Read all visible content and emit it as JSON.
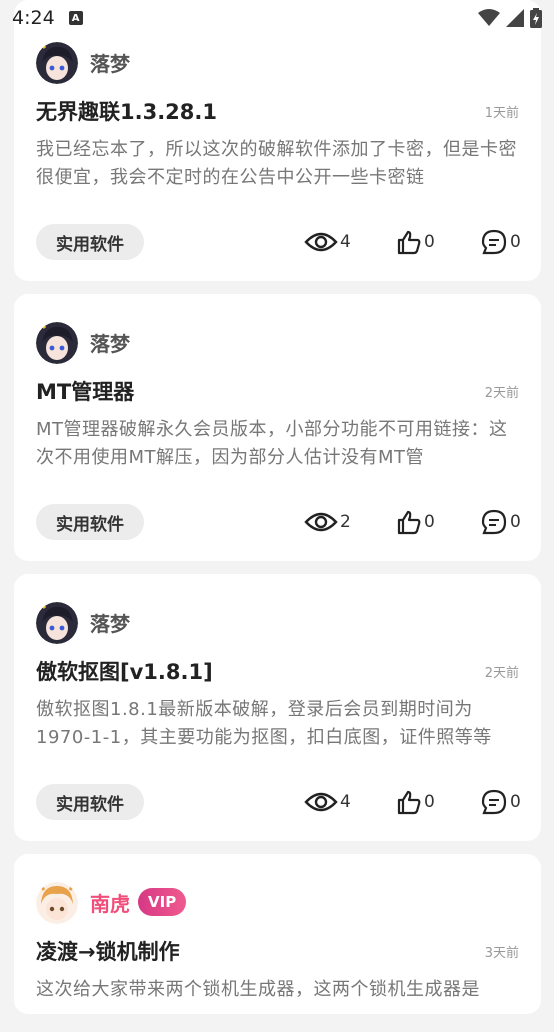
{
  "status_bar": {
    "time": "4:24"
  },
  "posts": [
    {
      "author": "落梦",
      "vip": false,
      "title": "无界趣联1.3.28.1",
      "time": "1天前",
      "summary": "我已经忘本了，所以这次的破解软件添加了卡密，但是卡密很便宜，我会不定时的在公告中公开一些卡密链",
      "tag": "实用软件",
      "views": "4",
      "likes": "0",
      "comments": "0"
    },
    {
      "author": "落梦",
      "vip": false,
      "title": "MT管理器",
      "time": "2天前",
      "summary": "MT管理器破解永久会员版本，小部分功能不可用链接：这次不用使用MT解压，因为部分人估计没有MT管",
      "tag": "实用软件",
      "views": "2",
      "likes": "0",
      "comments": "0"
    },
    {
      "author": "落梦",
      "vip": false,
      "title": "傲软抠图[v1.8.1]",
      "time": "2天前",
      "summary": "傲软抠图1.8.1最新版本破解，登录后会员到期时间为1970-1-1，其主要功能为抠图，扣白底图，证件照等等",
      "tag": "实用软件",
      "views": "4",
      "likes": "0",
      "comments": "0"
    },
    {
      "author": "南虎",
      "vip": true,
      "vip_label": "VIP",
      "title": "凌渡→锁机制作",
      "time": "3天前",
      "summary": "这次给大家带来两个锁机生成器，这两个锁机生成器是",
      "tag": "",
      "views": "",
      "likes": "",
      "comments": ""
    }
  ]
}
